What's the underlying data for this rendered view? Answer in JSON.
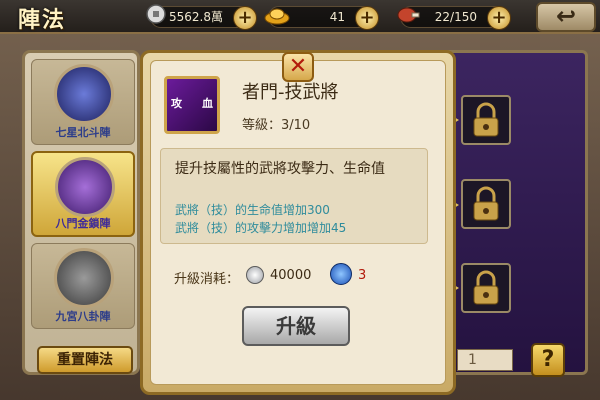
{
  "header": {
    "title": "陣法",
    "silver": "5562.8萬",
    "gold": "41",
    "stamina": "22/150",
    "back_icon": "back-arrow-icon"
  },
  "left_panel": {
    "formations": [
      {
        "label": "七星北斗陣",
        "active": false
      },
      {
        "label": "八門金鎖陣",
        "active": true
      },
      {
        "label": "九宮八卦陣",
        "active": false
      }
    ],
    "reset_label": "重置陣法"
  },
  "dialog": {
    "skill_icon_left": "攻",
    "skill_icon_right": "血",
    "skill_name": "者門-技武將",
    "level_text": "等級：3/10",
    "description": "提升技屬性的武將攻擊力、生命值",
    "bonus_1": "武將（技）的生命值增加300",
    "bonus_2": "武將（技）的攻擊力增加增加45",
    "cost_label": "升級消耗：",
    "cost_coins": "40000",
    "cost_gems": "3",
    "upgrade_label": "升級",
    "close_symbol": "✕"
  },
  "right_panel": {
    "count_value": "1",
    "help_symbol": "?"
  },
  "colors": {
    "accent": "#cfa639",
    "bonus_text": "#2f8c9c",
    "gem_cost": "#b21a0b"
  }
}
